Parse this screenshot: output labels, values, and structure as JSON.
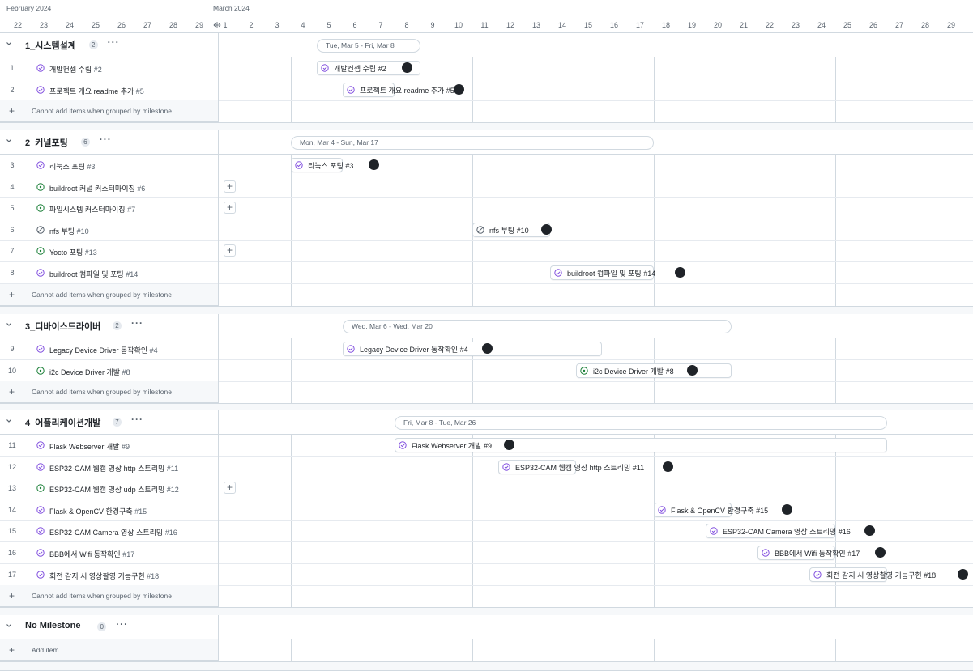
{
  "timeline": {
    "months": [
      {
        "label": "February 2024"
      },
      {
        "label": "March 2024"
      }
    ],
    "days": [
      "22",
      "23",
      "24",
      "25",
      "26",
      "27",
      "28",
      "29",
      "1",
      "2",
      "3",
      "4",
      "5",
      "6",
      "7",
      "8",
      "9",
      "10",
      "11",
      "12",
      "13",
      "14",
      "15",
      "16",
      "17",
      "18",
      "19",
      "20",
      "21",
      "22",
      "23",
      "24",
      "25",
      "26",
      "27",
      "28",
      "29"
    ]
  },
  "groups": [
    {
      "name": "1_시스템설계",
      "count": "2",
      "range_label": "Tue, Mar 5 - Fri, Mar 8",
      "add_label": "Cannot add items when grouped by milestone",
      "items": [
        {
          "num": "1",
          "title": "개발컨셉 수립",
          "ref": "#2",
          "status": "done"
        },
        {
          "num": "2",
          "title": "프로젝트 개요 readme 추가",
          "ref": "#5",
          "status": "done"
        }
      ]
    },
    {
      "name": "2_커널포팅",
      "count": "6",
      "range_label": "Mon, Mar 4 - Sun, Mar 17",
      "add_label": "Cannot add items when grouped by milestone",
      "items": [
        {
          "num": "3",
          "title": "리눅스 포팅",
          "ref": "#3",
          "status": "done"
        },
        {
          "num": "4",
          "title": "buildroot 커널 커스터마이징",
          "ref": "#6",
          "status": "open"
        },
        {
          "num": "5",
          "title": "파일시스템 커스터마이징",
          "ref": "#7",
          "status": "open"
        },
        {
          "num": "6",
          "title": "nfs 부팅",
          "ref": "#10",
          "status": "closed"
        },
        {
          "num": "7",
          "title": "Yocto 포팅",
          "ref": "#13",
          "status": "open"
        },
        {
          "num": "8",
          "title": "buildroot 컴파일 및 포팅",
          "ref": "#14",
          "status": "done"
        }
      ]
    },
    {
      "name": "3_디바이스드라이버",
      "count": "2",
      "range_label": "Wed, Mar 6 - Wed, Mar 20",
      "add_label": "Cannot add items when grouped by milestone",
      "items": [
        {
          "num": "9",
          "title": "Legacy Device Driver 동작확인",
          "ref": "#4",
          "status": "done"
        },
        {
          "num": "10",
          "title": "i2c Device Driver 개발",
          "ref": "#8",
          "status": "open"
        }
      ]
    },
    {
      "name": "4_어플리케이션개발",
      "count": "7",
      "range_label": "Fri, Mar 8 - Tue, Mar 26",
      "add_label": "Cannot add items when grouped by milestone",
      "items": [
        {
          "num": "11",
          "title": "Flask Webserver 개발",
          "ref": "#9",
          "status": "done"
        },
        {
          "num": "12",
          "title": "ESP32-CAM 웹캠 영상 http 스트리밍",
          "ref": "#11",
          "status": "done"
        },
        {
          "num": "13",
          "title": "ESP32-CAM 웹캠 영상 udp 스트리밍",
          "ref": "#12",
          "status": "open"
        },
        {
          "num": "14",
          "title": "Flask & OpenCV 환경구축",
          "ref": "#15",
          "status": "done"
        },
        {
          "num": "15",
          "title": "ESP32-CAM Camera 영상 스트리밍",
          "ref": "#16",
          "status": "done"
        },
        {
          "num": "16",
          "title": "BBB에서 Wifi 동작확인",
          "ref": "#17",
          "status": "done"
        },
        {
          "num": "17",
          "title": "회전 감지 시 영상촬영 기능구현",
          "ref": "#18",
          "status": "done"
        }
      ]
    },
    {
      "name": "No Milestone",
      "count": "0",
      "add_label": "Add item",
      "items": []
    }
  ],
  "colors": {
    "done": "#8250df",
    "open": "#1a7f37",
    "closed": "#59636e",
    "border": "#d1d9e0"
  }
}
